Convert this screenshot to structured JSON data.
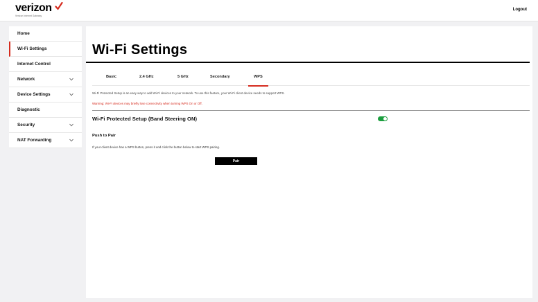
{
  "header": {
    "brand": "verizon",
    "brand_sub": "Verizon Internet Gateway",
    "logout_label": "Logout",
    "accent_color": "#d52b1e"
  },
  "sidebar": {
    "items": [
      {
        "label": "Home",
        "active": false,
        "expandable": false
      },
      {
        "label": "Wi-Fi Settings",
        "active": true,
        "expandable": false
      },
      {
        "label": "Internet Control",
        "active": false,
        "expandable": false
      },
      {
        "label": "Network",
        "active": false,
        "expandable": true
      },
      {
        "label": "Device Settings",
        "active": false,
        "expandable": true
      },
      {
        "label": "Diagnostic",
        "active": false,
        "expandable": false
      },
      {
        "label": "Security",
        "active": false,
        "expandable": true
      },
      {
        "label": "NAT Forwarding",
        "active": false,
        "expandable": true
      }
    ]
  },
  "main": {
    "title": "Wi-Fi Settings",
    "tabs": [
      {
        "label": "Basic",
        "active": false
      },
      {
        "label": "2.4 GHz",
        "active": false
      },
      {
        "label": "5 GHz",
        "active": false
      },
      {
        "label": "Secondary",
        "active": false
      },
      {
        "label": "WPS",
        "active": true
      }
    ],
    "description": "Wi-Fi Protected Setup is an easy way to add Wi-Fi devices to your network. To use this feature, your Wi-Fi client device needs to support WPS.",
    "warning": "Warning: Wi-Fi devices may briefly lose connectivity when turning WPS On or Off.",
    "wps_section": {
      "title": "Wi-Fi Protected Setup  (Band Steering ON)",
      "toggle_on": true,
      "toggle_color": "#1b9e3e"
    },
    "push_to_pair": {
      "title": "Push to Pair",
      "description": "If your client device has a WPS button, press it and click the button below to start WPS pairing.",
      "button_label": "Pair"
    }
  }
}
